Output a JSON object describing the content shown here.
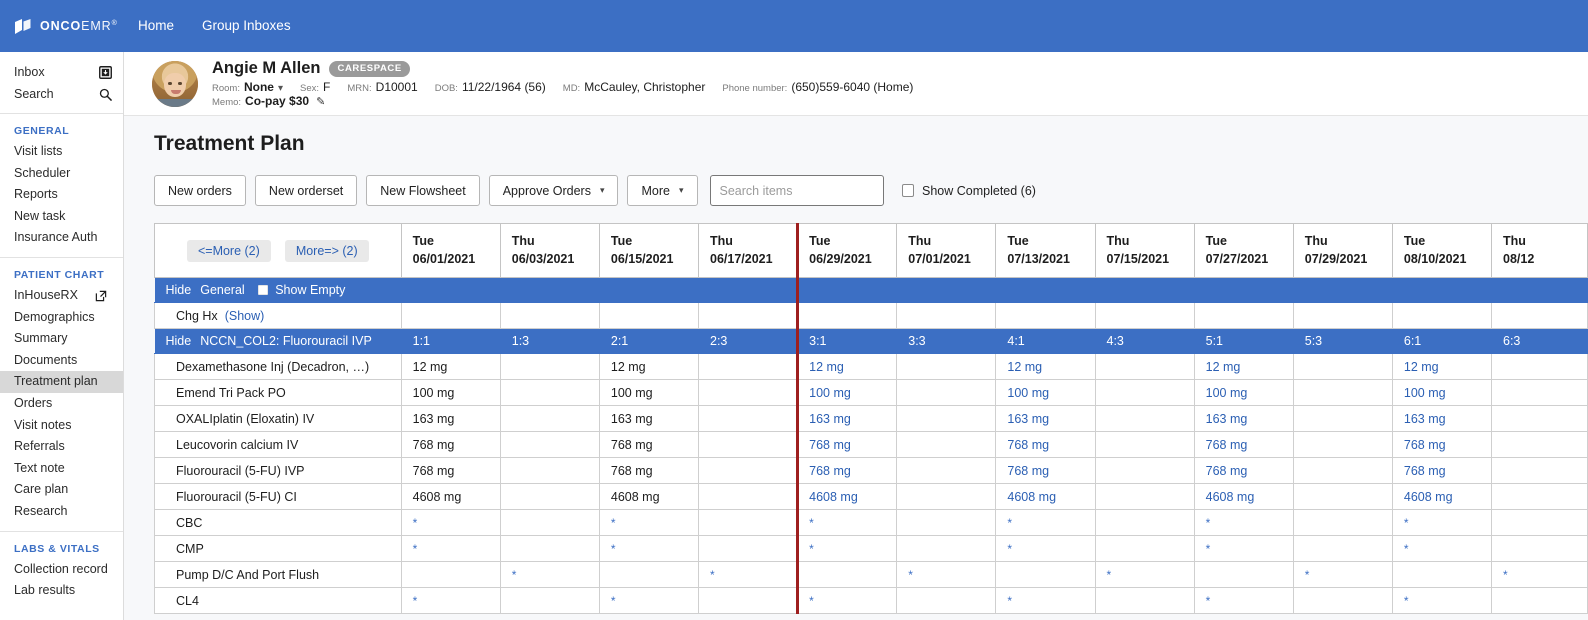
{
  "topnav": {
    "logo_text_bold": "ONCO",
    "logo_text_light": "EMR",
    "logo_icon": "oncoemr-logo-icon",
    "links": [
      {
        "label": "Home"
      },
      {
        "label": "Group Inboxes"
      }
    ]
  },
  "sidebar": {
    "top_rows": [
      {
        "label": "Inbox",
        "icon": "inbox-icon"
      },
      {
        "label": "Search",
        "icon": "search-icon"
      }
    ],
    "sections": [
      {
        "title": "GENERAL",
        "items": [
          {
            "label": "Visit lists"
          },
          {
            "label": "Scheduler"
          },
          {
            "label": "Reports"
          },
          {
            "label": "New task"
          },
          {
            "label": "Insurance Auth"
          }
        ]
      },
      {
        "title": "PATIENT CHART",
        "items": [
          {
            "label": "InHouseRX",
            "icon": "external-link-icon"
          },
          {
            "label": "Demographics"
          },
          {
            "label": "Summary"
          },
          {
            "label": "Documents"
          },
          {
            "label": "Treatment plan",
            "active": true
          },
          {
            "label": "Orders"
          },
          {
            "label": "Visit notes"
          },
          {
            "label": "Referrals"
          },
          {
            "label": "Text note"
          },
          {
            "label": "Care plan"
          },
          {
            "label": "Research"
          }
        ]
      },
      {
        "title": "LABS & VITALS",
        "items": [
          {
            "label": "Collection record"
          },
          {
            "label": "Lab results"
          }
        ]
      }
    ]
  },
  "patient": {
    "avatar": "patient-photo",
    "name": "Angie M Allen",
    "badge": "CARESPACE",
    "fields": [
      {
        "key": "Room:",
        "value": "None",
        "dropdown": true
      },
      {
        "key": "Sex:",
        "value": "F"
      },
      {
        "key": "MRN:",
        "value": "D10001"
      },
      {
        "key": "DOB:",
        "value": "11/22/1964 (56)"
      },
      {
        "key": "MD:",
        "value": "McCauley, Christopher"
      },
      {
        "key": "Phone number:",
        "value": "(650)559-6040 (Home)"
      }
    ],
    "memo_key": "Memo:",
    "memo_value": "Co-pay $30",
    "memo_edit_icon": "pencil-icon"
  },
  "page": {
    "title": "Treatment Plan"
  },
  "toolbar": {
    "buttons": [
      {
        "label": "New orders",
        "caret": false
      },
      {
        "label": "New orderset",
        "caret": false
      },
      {
        "label": "New Flowsheet",
        "caret": false
      },
      {
        "label": "Approve Orders",
        "caret": true
      },
      {
        "label": "More",
        "caret": true
      }
    ],
    "search_placeholder": "Search items",
    "search_value": "",
    "search_icon": "search-icon",
    "show_completed_label": "Show Completed (6)",
    "show_completed_checked": false
  },
  "grid": {
    "nav_prev": "<=More (2)",
    "nav_next": "More=> (2)",
    "today_column_index": 4,
    "columns": [
      {
        "dow": "Tue",
        "date": "06/01/2021",
        "cycle": "1:1",
        "future": false
      },
      {
        "dow": "Thu",
        "date": "06/03/2021",
        "cycle": "1:3",
        "future": false
      },
      {
        "dow": "Tue",
        "date": "06/15/2021",
        "cycle": "2:1",
        "future": false
      },
      {
        "dow": "Thu",
        "date": "06/17/2021",
        "cycle": "2:3",
        "future": false
      },
      {
        "dow": "Tue",
        "date": "06/29/2021",
        "cycle": "3:1",
        "future": true
      },
      {
        "dow": "Thu",
        "date": "07/01/2021",
        "cycle": "3:3",
        "future": true
      },
      {
        "dow": "Tue",
        "date": "07/13/2021",
        "cycle": "4:1",
        "future": true
      },
      {
        "dow": "Thu",
        "date": "07/15/2021",
        "cycle": "4:3",
        "future": true
      },
      {
        "dow": "Tue",
        "date": "07/27/2021",
        "cycle": "5:1",
        "future": true
      },
      {
        "dow": "Thu",
        "date": "07/29/2021",
        "cycle": "5:3",
        "future": true
      },
      {
        "dow": "Tue",
        "date": "08/10/2021",
        "cycle": "6:1",
        "future": true
      },
      {
        "dow": "Thu",
        "date": "08/12",
        "cycle": "6:3",
        "future": true
      }
    ],
    "section_general": {
      "hide_label": "Hide",
      "name": "General",
      "show_empty_label": "Show Empty",
      "show_empty_checked": false
    },
    "chg_hx": {
      "label": "Chg Hx",
      "show_link": "(Show)"
    },
    "section_regimen": {
      "hide_label": "Hide",
      "name": "NCCN_COL2: Fluorouracil IVP"
    },
    "rows": [
      {
        "name": "Dexamethasone Inj (Decadron, …)",
        "values": [
          "12 mg",
          "",
          "12 mg",
          "",
          "12 mg",
          "",
          "12 mg",
          "",
          "12 mg",
          "",
          "12 mg",
          ""
        ]
      },
      {
        "name": "Emend Tri Pack PO",
        "values": [
          "100 mg",
          "",
          "100 mg",
          "",
          "100 mg",
          "",
          "100 mg",
          "",
          "100 mg",
          "",
          "100 mg",
          ""
        ]
      },
      {
        "name": "OXALIplatin (Eloxatin) IV",
        "values": [
          "163 mg",
          "",
          "163 mg",
          "",
          "163 mg",
          "",
          "163 mg",
          "",
          "163 mg",
          "",
          "163 mg",
          ""
        ]
      },
      {
        "name": "Leucovorin calcium IV",
        "values": [
          "768 mg",
          "",
          "768 mg",
          "",
          "768 mg",
          "",
          "768 mg",
          "",
          "768 mg",
          "",
          "768 mg",
          ""
        ]
      },
      {
        "name": "Fluorouracil (5-FU) IVP",
        "values": [
          "768 mg",
          "",
          "768 mg",
          "",
          "768 mg",
          "",
          "768 mg",
          "",
          "768 mg",
          "",
          "768 mg",
          ""
        ]
      },
      {
        "name": "Fluorouracil (5-FU) CI",
        "values": [
          "4608 mg",
          "",
          "4608 mg",
          "",
          "4608 mg",
          "",
          "4608 mg",
          "",
          "4608 mg",
          "",
          "4608 mg",
          ""
        ]
      },
      {
        "name": "CBC",
        "values": [
          "*",
          "",
          "*",
          "",
          "*",
          "",
          "*",
          "",
          "*",
          "",
          "*",
          ""
        ]
      },
      {
        "name": "CMP",
        "values": [
          "*",
          "",
          "*",
          "",
          "*",
          "",
          "*",
          "",
          "*",
          "",
          "*",
          ""
        ]
      },
      {
        "name": "Pump D/C And Port Flush",
        "values": [
          "",
          "*",
          "",
          "*",
          "",
          "*",
          "",
          "*",
          "",
          "*",
          "",
          "*"
        ]
      },
      {
        "name": "CL4",
        "values": [
          "*",
          "",
          "*",
          "",
          "*",
          "",
          "*",
          "",
          "*",
          "",
          "*",
          ""
        ]
      }
    ]
  },
  "colors": {
    "brand_blue": "#3c6fc4",
    "link_blue": "#2b5fb3",
    "today_red": "#9e1f1f"
  }
}
